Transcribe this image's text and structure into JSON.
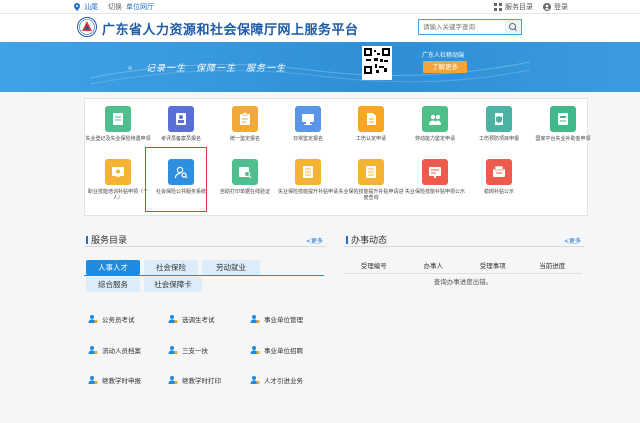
{
  "topbar": {
    "location": "汕尾",
    "switch_label": "切换",
    "unit_hall": "单位网厅",
    "service_catalog": "服务目录",
    "login": "登录"
  },
  "header": {
    "title": "广东省人力资源和社会保障厅网上服务平台",
    "search_placeholder": "请输入关键字查询"
  },
  "banner": {
    "slogan": "记录一生　保障一生　服务一生",
    "mobile_text": "广东人社移动端",
    "more_label": "了解更多"
  },
  "grid": {
    "row1": [
      {
        "label": "失业登记及失业保险待遇申领",
        "color": "#4fc08d",
        "icon": "book-icon"
      },
      {
        "label": "考评员备案员报名",
        "color": "#5b6fd8",
        "icon": "id-card-icon"
      },
      {
        "label": "统一鉴定报名",
        "color": "#f2a93b",
        "icon": "clipboard-icon"
      },
      {
        "label": "日常鉴定报名",
        "color": "#5a96e8",
        "icon": "monitor-icon"
      },
      {
        "label": "工伤认定申请",
        "color": "#f5a623",
        "icon": "document-icon"
      },
      {
        "label": "劳动能力鉴定申请",
        "color": "#4fbf88",
        "icon": "people-icon"
      },
      {
        "label": "工伤预防项目申报",
        "color": "#4cb3a4",
        "icon": "shield-file-icon"
      },
      {
        "label": "国家平台失业补助金申领",
        "color": "#3fb98a",
        "icon": "paper-icon"
      }
    ],
    "row2": [
      {
        "label": "职业技能培训补贴申领（个人）",
        "color": "#f5b335",
        "icon": "certificate-icon"
      },
      {
        "label": "社会保险公共服务系统",
        "color": "#2e8fe0",
        "icon": "user-search-icon"
      },
      {
        "label": "自助打印单据在线验证",
        "color": "#4fc08d",
        "icon": "print-search-icon"
      },
      {
        "label": "失业保险技能提升补贴申请",
        "color": "#f5b335",
        "icon": "list-icon"
      },
      {
        "label": "失业保险技能提升补贴申请进度查询",
        "color": "#f5b335",
        "icon": "list-icon"
      },
      {
        "label": "失业保险技能补贴申领公示",
        "color": "#ec5b4b",
        "icon": "board-icon"
      },
      {
        "label": "稳岗补贴公示",
        "color": "#ec5b4b",
        "icon": "box-icon"
      }
    ]
  },
  "catalog": {
    "title": "服务目录",
    "more": "<更多",
    "tabs": [
      "人事人才",
      "社会保险",
      "劳动就业",
      "综合服务",
      "社会保障卡"
    ],
    "services": [
      "公务员考试",
      "选调生考试",
      "事业单位管理",
      "流动人员档案",
      "三支一扶",
      "事业单位招聘",
      "继教学时申报",
      "继教学时打印",
      "人才引进业务"
    ]
  },
  "activity": {
    "title": "办事动态",
    "more": "<更多",
    "columns": [
      "受理编号",
      "办事人",
      "受理事项",
      "当前进度"
    ],
    "empty": "查询办事进度出错。"
  }
}
